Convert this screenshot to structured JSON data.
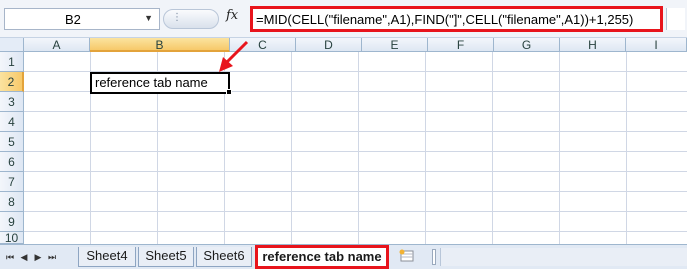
{
  "formula_bar": {
    "name_box": "B2",
    "name_box_arrow": "▼",
    "grip": "⋮",
    "fx": "fx",
    "formula": "=MID(CELL(\"filename\",A1),FIND(\"]\",CELL(\"filename\",A1))+1,255)"
  },
  "columns": [
    "A",
    "B",
    "C",
    "D",
    "E",
    "F",
    "G",
    "H",
    "I"
  ],
  "rows": [
    "1",
    "2",
    "3",
    "4",
    "5",
    "6",
    "7",
    "8",
    "9",
    "10"
  ],
  "active_cell": {
    "ref": "B2",
    "value": "reference tab name"
  },
  "tab_bar": {
    "nav": [
      "⏮",
      "◀",
      "▶",
      "⏭"
    ],
    "tabs": [
      "Sheet4",
      "Sheet5",
      "Sheet6",
      "reference tab name"
    ],
    "active_tab": "reference tab name",
    "new_sheet_icon": "insert-worksheet-icon"
  },
  "colors": {
    "highlight": "#e8141c",
    "active_header": "#f7c96a",
    "gridline": "#d0d7e5"
  }
}
